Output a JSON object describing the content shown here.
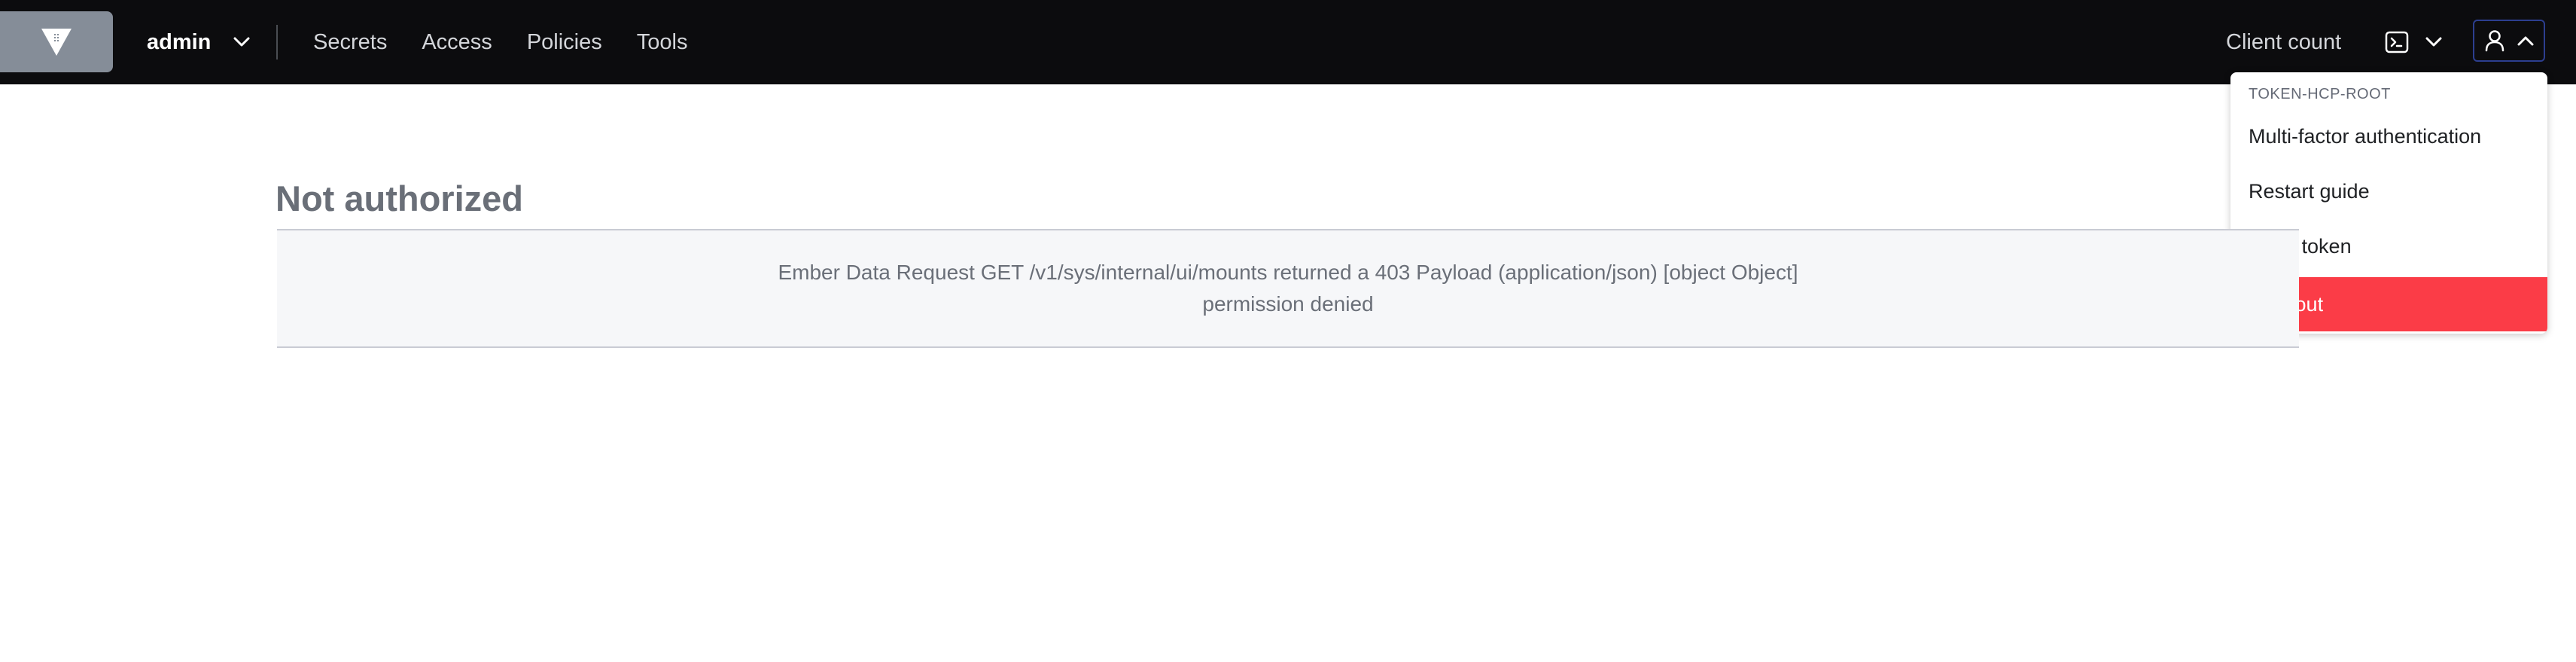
{
  "header": {
    "logo_icon": "vault-logo-icon",
    "namespace": "admin",
    "nav": [
      "Secrets",
      "Access",
      "Policies",
      "Tools"
    ],
    "client_count": "Client count",
    "console_icon": "terminal-icon",
    "user_icon": "user-icon"
  },
  "user_menu": {
    "token_name": "TOKEN-HCP-ROOT",
    "items": [
      "Multi-factor authentication",
      "Restart guide",
      "Copy token"
    ],
    "sign_out": "Sign out"
  },
  "main": {
    "title": "Not authorized",
    "error_line1": "Ember Data Request GET /v1/sys/internal/ui/mounts returned a 403 Payload (application/json) [object Object]",
    "error_line2": "permission denied"
  },
  "colors": {
    "topbar": "#0c0c0e",
    "logo_bg": "#858d98",
    "sign_out_bg": "#fb3c47",
    "user_button_border": "#2c3e8f"
  }
}
